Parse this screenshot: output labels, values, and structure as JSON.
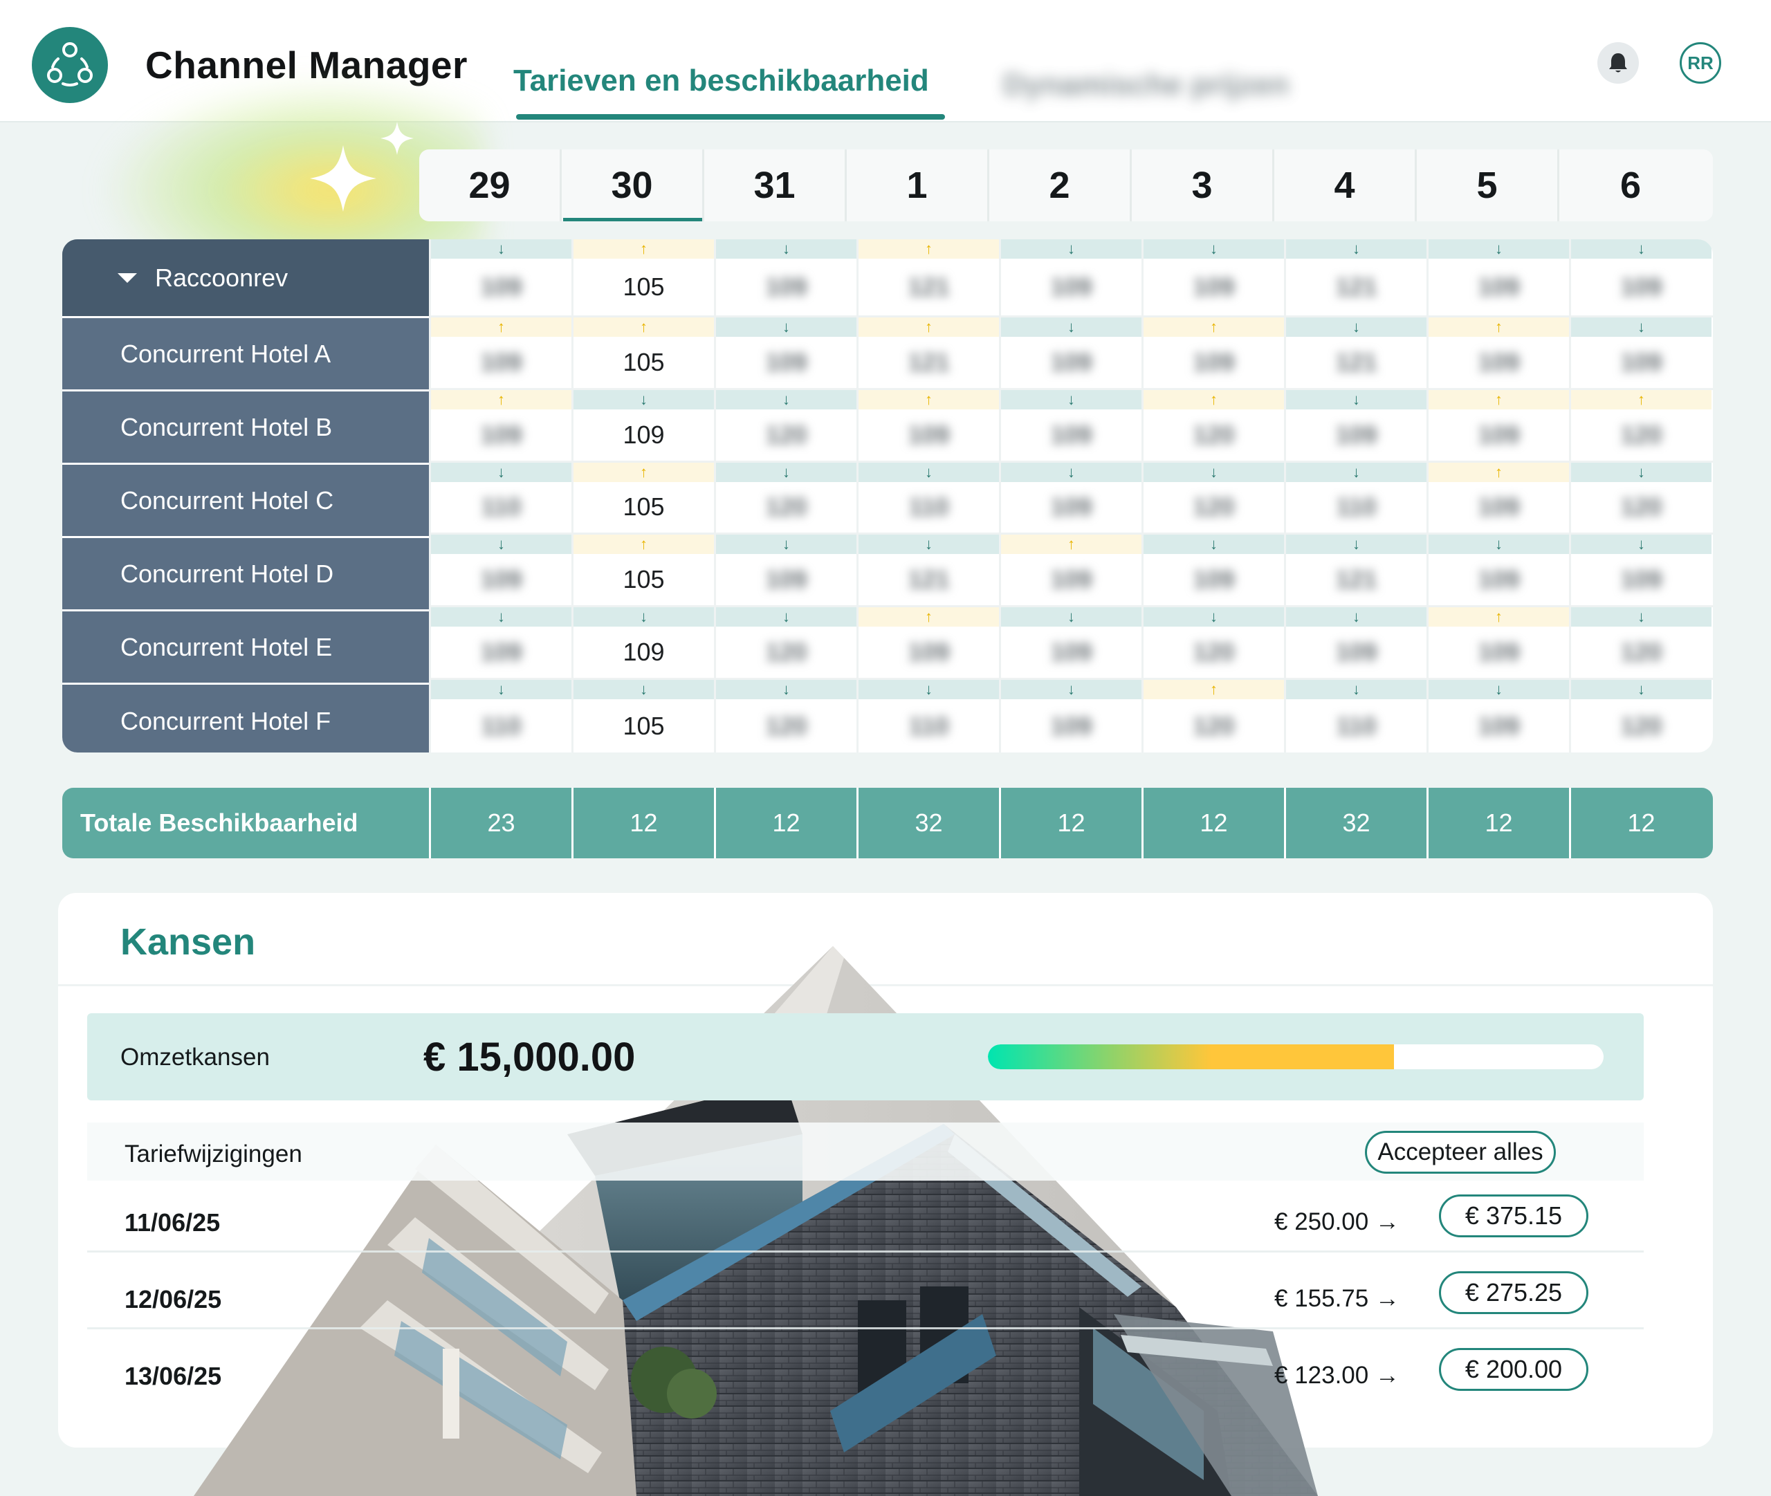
{
  "header": {
    "app_title": "Channel Manager",
    "tab_active": "Tarieven en beschikbaarheid",
    "tab_inactive": "Dynamische prijzen",
    "avatar_initials": "RR",
    "accent_color": "#23867b"
  },
  "dates": [
    {
      "label": "29"
    },
    {
      "label": "30",
      "selected": true
    },
    {
      "label": "31"
    },
    {
      "label": "1"
    },
    {
      "label": "2"
    },
    {
      "label": "3"
    },
    {
      "label": "4"
    },
    {
      "label": "5"
    },
    {
      "label": "6"
    }
  ],
  "grid": {
    "rows": [
      {
        "name": "Raccoonrev",
        "expanded": true,
        "cells": [
          {
            "dir": "down",
            "value": "109"
          },
          {
            "dir": "up",
            "value": "105"
          },
          {
            "dir": "down",
            "value": "109"
          },
          {
            "dir": "up",
            "value": "121"
          },
          {
            "dir": "down",
            "value": "109"
          },
          {
            "dir": "down",
            "value": "109"
          },
          {
            "dir": "down",
            "value": "121"
          },
          {
            "dir": "down",
            "value": "109"
          },
          {
            "dir": "down",
            "value": "109"
          }
        ]
      },
      {
        "name": "Concurrent Hotel A",
        "cells": [
          {
            "dir": "up",
            "value": "109"
          },
          {
            "dir": "up",
            "value": "105"
          },
          {
            "dir": "down",
            "value": "109"
          },
          {
            "dir": "up",
            "value": "121"
          },
          {
            "dir": "down",
            "value": "109"
          },
          {
            "dir": "up",
            "value": "109"
          },
          {
            "dir": "down",
            "value": "121"
          },
          {
            "dir": "up",
            "value": "109"
          },
          {
            "dir": "down",
            "value": "109"
          }
        ]
      },
      {
        "name": "Concurrent Hotel B",
        "cells": [
          {
            "dir": "up",
            "value": "109"
          },
          {
            "dir": "down",
            "value": "109"
          },
          {
            "dir": "down",
            "value": "120"
          },
          {
            "dir": "up",
            "value": "109"
          },
          {
            "dir": "down",
            "value": "109"
          },
          {
            "dir": "up",
            "value": "120"
          },
          {
            "dir": "down",
            "value": "109"
          },
          {
            "dir": "up",
            "value": "109"
          },
          {
            "dir": "up",
            "value": "120"
          }
        ]
      },
      {
        "name": "Concurrent Hotel C",
        "cells": [
          {
            "dir": "down",
            "value": "110"
          },
          {
            "dir": "up",
            "value": "105"
          },
          {
            "dir": "down",
            "value": "120"
          },
          {
            "dir": "down",
            "value": "110"
          },
          {
            "dir": "down",
            "value": "109"
          },
          {
            "dir": "down",
            "value": "120"
          },
          {
            "dir": "down",
            "value": "110"
          },
          {
            "dir": "up",
            "value": "109"
          },
          {
            "dir": "down",
            "value": "120"
          }
        ]
      },
      {
        "name": "Concurrent Hotel D",
        "cells": [
          {
            "dir": "down",
            "value": "109"
          },
          {
            "dir": "up",
            "value": "105"
          },
          {
            "dir": "down",
            "value": "109"
          },
          {
            "dir": "down",
            "value": "121"
          },
          {
            "dir": "up",
            "value": "109"
          },
          {
            "dir": "down",
            "value": "109"
          },
          {
            "dir": "down",
            "value": "121"
          },
          {
            "dir": "down",
            "value": "109"
          },
          {
            "dir": "down",
            "value": "109"
          }
        ]
      },
      {
        "name": "Concurrent Hotel E",
        "cells": [
          {
            "dir": "down",
            "value": "109"
          },
          {
            "dir": "down",
            "value": "109"
          },
          {
            "dir": "down",
            "value": "120"
          },
          {
            "dir": "up",
            "value": "109"
          },
          {
            "dir": "down",
            "value": "109"
          },
          {
            "dir": "down",
            "value": "120"
          },
          {
            "dir": "down",
            "value": "109"
          },
          {
            "dir": "up",
            "value": "109"
          },
          {
            "dir": "down",
            "value": "120"
          }
        ]
      },
      {
        "name": "Concurrent Hotel F",
        "cells": [
          {
            "dir": "down",
            "value": "110"
          },
          {
            "dir": "down",
            "value": "105"
          },
          {
            "dir": "down",
            "value": "120"
          },
          {
            "dir": "down",
            "value": "110"
          },
          {
            "dir": "down",
            "value": "109"
          },
          {
            "dir": "up",
            "value": "120"
          },
          {
            "dir": "down",
            "value": "110"
          },
          {
            "dir": "down",
            "value": "109"
          },
          {
            "dir": "down",
            "value": "120"
          }
        ]
      }
    ]
  },
  "total": {
    "label": "Totale Beschikbaarheid",
    "values": [
      "23",
      "12",
      "12",
      "32",
      "12",
      "12",
      "32",
      "12",
      "12"
    ]
  },
  "kansen": {
    "title": "Kansen",
    "omzet_label": "Omzetkansen",
    "omzet_value": "€ 15,000.00",
    "progress_fraction": 0.66,
    "rate_changes_label": "Tariefwijzigingen",
    "accept_all_label": "Accepteer alles",
    "changes": [
      {
        "date": "11/06/25",
        "old": "€ 250.00 →",
        "new": "€ 375.15"
      },
      {
        "date": "12/06/25",
        "old": "€ 155.75 →",
        "new": "€ 275.25"
      },
      {
        "date": "13/06/25",
        "old": "€ 123.00 →",
        "new": "€ 200.00"
      }
    ]
  },
  "icons": {
    "logo": "share-nodes-icon",
    "bell": "bell-icon",
    "sparkle": "sparkle-icon",
    "arrow_up": "↑",
    "arrow_down": "↓"
  }
}
